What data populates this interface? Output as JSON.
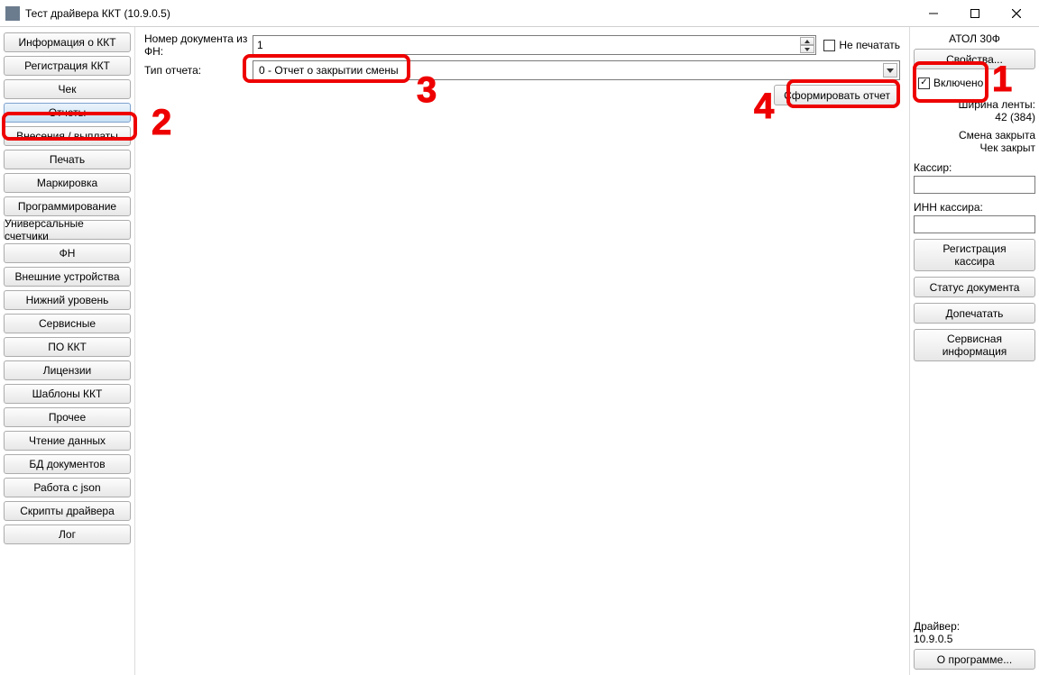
{
  "window": {
    "title": "Тест драйвера ККТ (10.9.0.5)"
  },
  "sidebar": {
    "items": [
      {
        "label": "Информация о ККТ"
      },
      {
        "label": "Регистрация ККТ"
      },
      {
        "label": "Чек"
      },
      {
        "label": "Отчеты"
      },
      {
        "label": "Внесения / выплаты"
      },
      {
        "label": "Печать"
      },
      {
        "label": "Маркировка"
      },
      {
        "label": "Программирование"
      },
      {
        "label": "Универсальные счетчики"
      },
      {
        "label": "ФН"
      },
      {
        "label": "Внешние устройства"
      },
      {
        "label": "Нижний уровень"
      },
      {
        "label": "Сервисные"
      },
      {
        "label": "ПО ККТ"
      },
      {
        "label": "Лицензии"
      },
      {
        "label": "Шаблоны ККТ"
      },
      {
        "label": "Прочее"
      },
      {
        "label": "Чтение данных"
      },
      {
        "label": "БД документов"
      },
      {
        "label": "Работа с json"
      },
      {
        "label": "Скрипты драйвера"
      },
      {
        "label": "Лог"
      }
    ],
    "active_index": 3
  },
  "center": {
    "doc_number_label": "Номер документа из ФН:",
    "doc_number_value": "1",
    "no_print_label": "Не печатать",
    "no_print_checked": false,
    "report_type_label": "Тип отчета:",
    "report_type_value": "0 - Отчет о закрытии смены",
    "generate_label": "Сформировать отчет"
  },
  "right": {
    "device_name": "АТОЛ 30Ф",
    "properties_label": "Свойства...",
    "enabled_label": "Включено",
    "enabled_checked": true,
    "tape_width_label": "Ширина ленты:",
    "tape_width_value": "42 (384)",
    "shift_status": "Смена закрыта",
    "check_status": "Чек закрыт",
    "cashier_label": "Кассир:",
    "cashier_value": "",
    "cashier_inn_label": "ИНН кассира:",
    "cashier_inn_value": "",
    "reg_cashier_label": "Регистрация\nкассира",
    "doc_status_label": "Статус документа",
    "reprint_label": "Допечатать",
    "service_info_label": "Сервисная\nинформация",
    "driver_label": "Драйвер:",
    "driver_version": "10.9.0.5",
    "about_label": "О программе..."
  },
  "annotations": {
    "n1": "1",
    "n2": "2",
    "n3": "3",
    "n4": "4"
  }
}
